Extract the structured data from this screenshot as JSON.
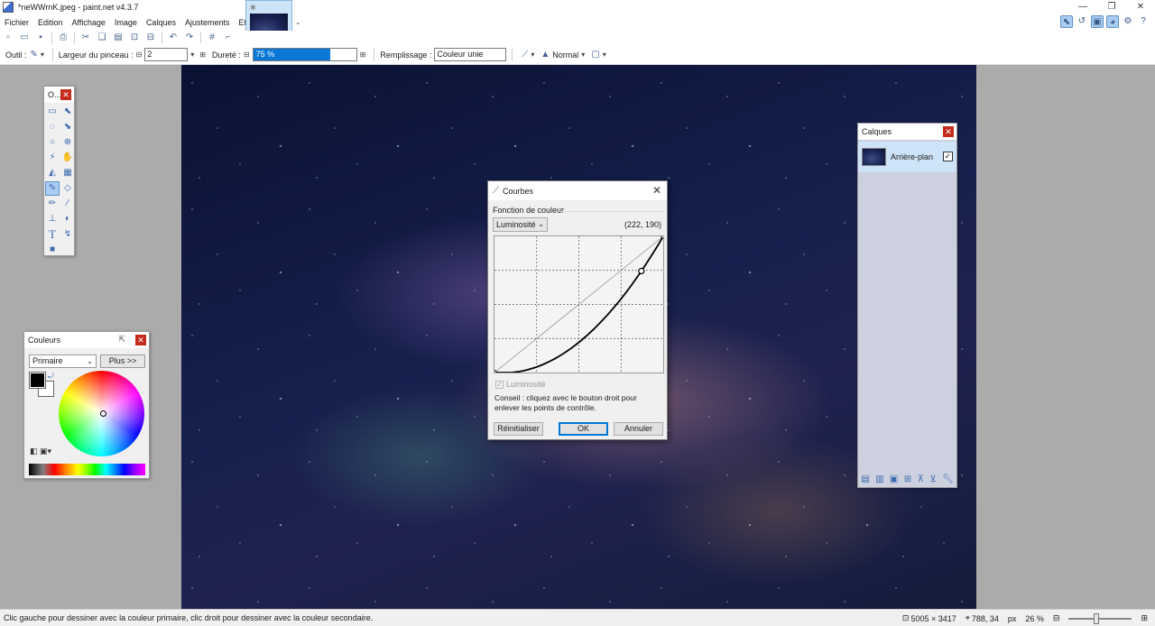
{
  "window": {
    "title": "*neWWrnK.jpeg - paint.net v4.3.7",
    "controls": [
      "—",
      "❐",
      "✕"
    ]
  },
  "menu": [
    "Fichier",
    "Edition",
    "Affichage",
    "Image",
    "Calques",
    "Ajustements",
    "Effets"
  ],
  "options": {
    "tool_label": "Outil :",
    "brush_width_label": "Largeur du pinceau :",
    "brush_width_value": "2",
    "hardness_label": "Dureté :",
    "hardness_value": "75 %",
    "hardness_fraction": 0.75,
    "fill_label": "Remplissage :",
    "fill_value": "Couleur unie",
    "blend_mode": "Normal"
  },
  "colors_panel": {
    "title": "Couleurs",
    "select_value": "Primaire",
    "more_button": "Plus >>",
    "primary_color": "#000000",
    "secondary_color": "#ffffff"
  },
  "tools_panel": {
    "title": "O...",
    "tools": [
      "rectangle-select-icon",
      "move-selection-icon",
      "lasso-select-icon",
      "move-selected-icon",
      "ellipse-select-icon",
      "zoom-icon",
      "magic-wand-icon",
      "pan-icon",
      "paint-bucket-icon",
      "gradient-icon",
      "paintbrush-icon",
      "eraser-icon",
      "pencil-icon",
      "color-picker-icon",
      "clone-stamp-icon",
      "recolor-icon",
      "text-icon",
      "line-curve-icon",
      "shapes-icon"
    ],
    "selected_tool": "paintbrush-icon"
  },
  "layers_panel": {
    "title": "Calques",
    "layers": [
      {
        "name": "Arrière-plan",
        "visible": true
      }
    ]
  },
  "curves_dialog": {
    "title": "Courbes",
    "group_label": "Fonction de couleur",
    "mode": "Luminosité",
    "coords": "(222, 190)",
    "channel_checkbox_label": "Luminosité",
    "hint": "Conseil : cliquez avec le bouton droit pour enlever les points de contrôle.",
    "reset_button": "Réinitialiser",
    "ok_button": "OK",
    "cancel_button": "Annuler",
    "control_points": [
      [
        0,
        0
      ],
      [
        222,
        190
      ],
      [
        255,
        255
      ]
    ]
  },
  "statusbar": {
    "hint": "Clic gauche pour dessiner avec la couleur primaire, clic droit pour dessiner avec la couleur secondaire.",
    "image_size": "5005 × 3417",
    "cursor_pos": "788, 34",
    "units": "px",
    "zoom": "26 %"
  }
}
